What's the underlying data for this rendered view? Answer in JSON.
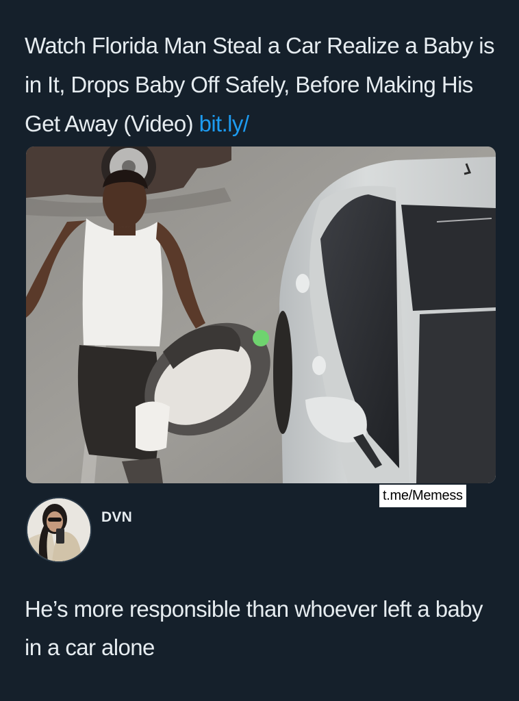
{
  "post": {
    "text": "Watch Florida Man Steal a Car Realize a Baby is in It, Drops Baby Off Safely, Before Making His Get Away (Video) ",
    "link": "bit.ly/"
  },
  "media": {
    "watermark": "t.me/Memess"
  },
  "reply": {
    "username": "DVN",
    "text": "He’s more responsible than whoever left a baby in a car alone"
  },
  "colors": {
    "background": "#15202b",
    "text": "#e6ecf0",
    "link": "#1d9bf0"
  }
}
